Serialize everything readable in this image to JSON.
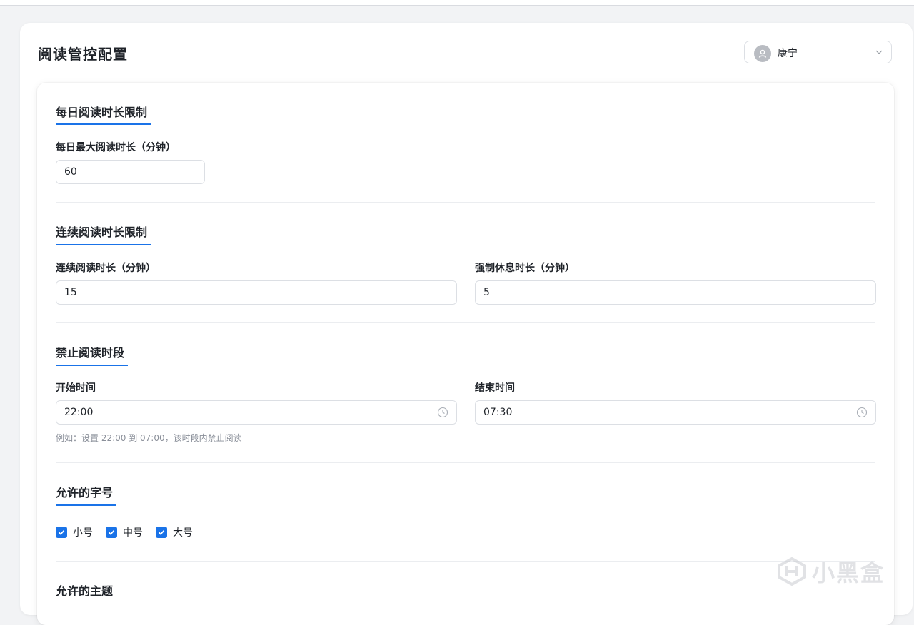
{
  "page": {
    "title": "阅读管控配置"
  },
  "user": {
    "name": "康宁",
    "avatar_icon": "user-icon"
  },
  "sections": {
    "daily": {
      "title": "每日阅读时长限制",
      "max_label": "每日最大阅读时长（分钟）",
      "max_value": "60"
    },
    "continuous": {
      "title": "连续阅读时长限制",
      "duration_label": "连续阅读时长（分钟）",
      "duration_value": "15",
      "rest_label": "强制休息时长（分钟）",
      "rest_value": "5"
    },
    "forbidden": {
      "title": "禁止阅读时段",
      "start_label": "开始时间",
      "start_value": "22:00",
      "end_label": "结束时间",
      "end_value": "07:30",
      "hint": "例如：设置 22:00 到 07:00，该时段内禁止阅读"
    },
    "font_sizes": {
      "title": "允许的字号",
      "options": [
        {
          "label": "小号",
          "checked": true
        },
        {
          "label": "中号",
          "checked": true
        },
        {
          "label": "大号",
          "checked": true
        }
      ]
    },
    "themes": {
      "title": "允许的主题"
    }
  },
  "watermark": {
    "text": "小黑盒"
  },
  "colors": {
    "accent": "#1a73e8",
    "border": "#dcdfe4",
    "background": "#f2f3f5"
  }
}
